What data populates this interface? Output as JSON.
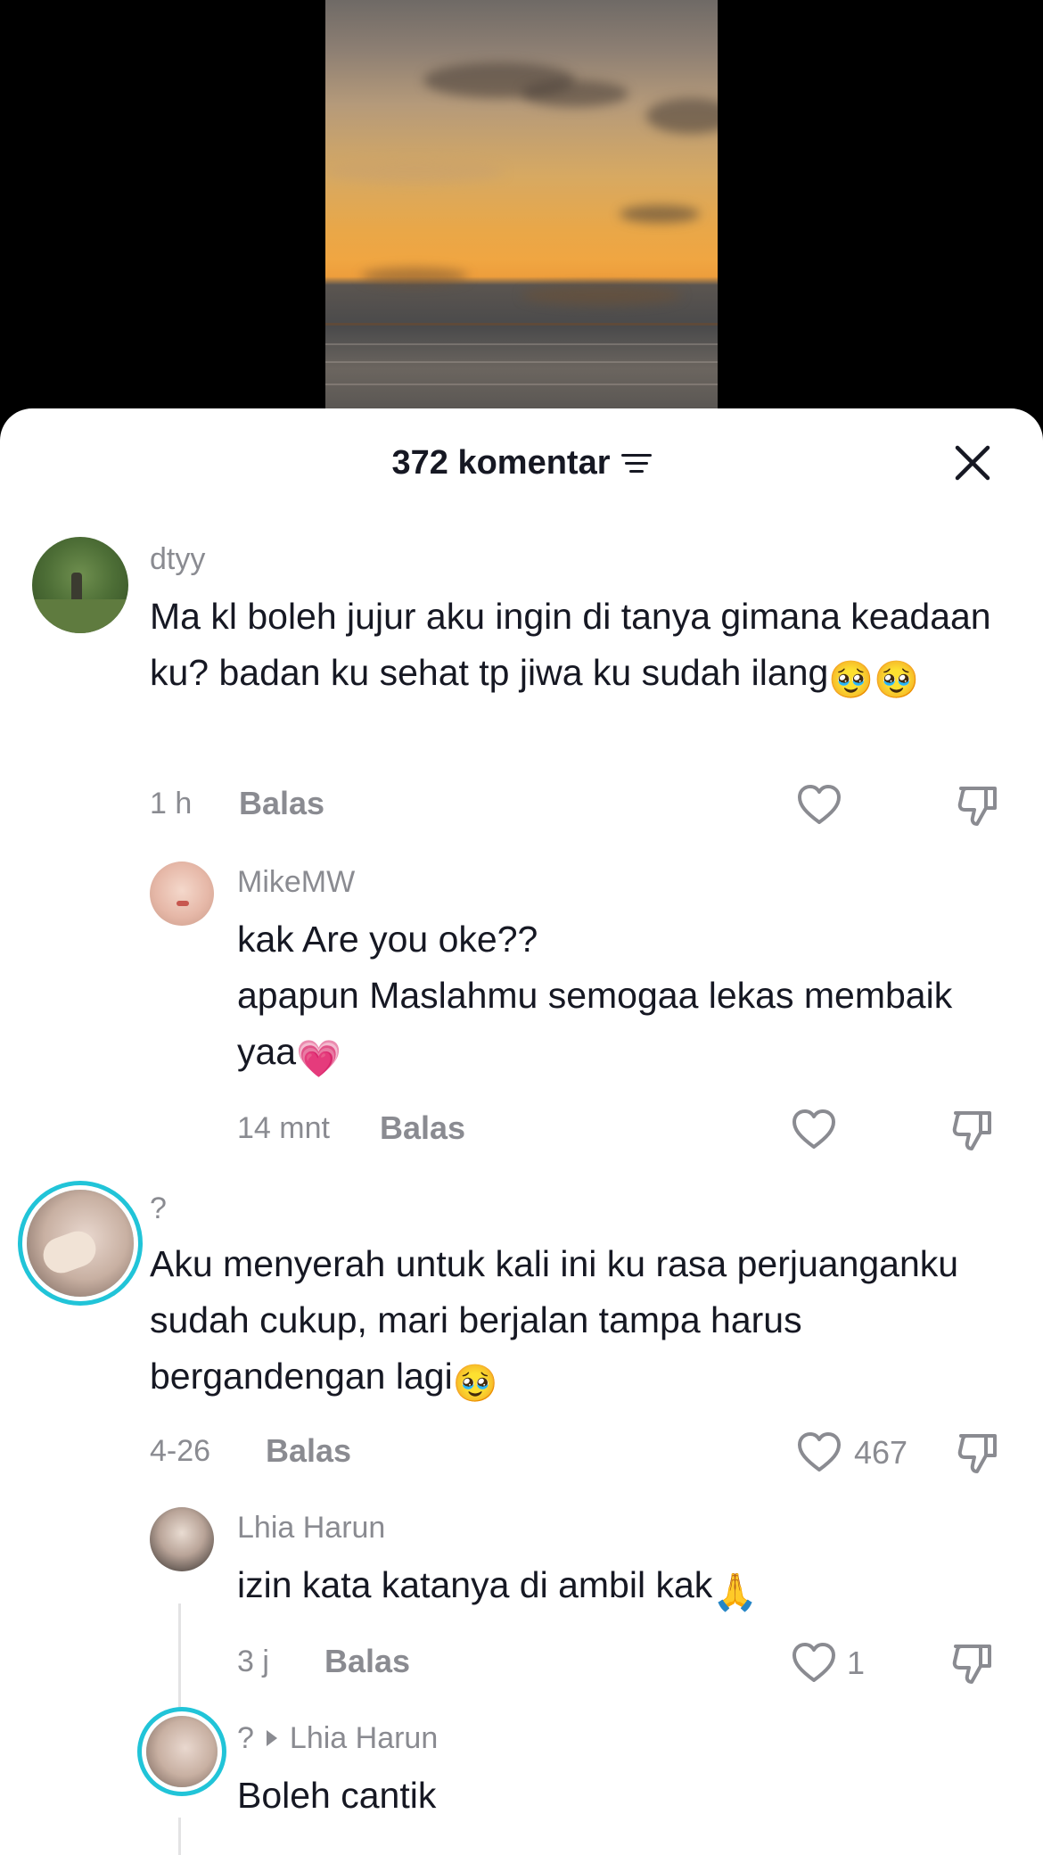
{
  "header": {
    "title": "372 komentar"
  },
  "comments": [
    {
      "username": "dtyy",
      "text": "Ma kl boleh jujur aku ingin di tanya gimana keadaan ku? badan ku sehat tp jiwa ku sudah ilang",
      "emoji": "🥹🥹",
      "time": "1 h",
      "reply_label": "Balas"
    },
    {
      "username": "MikeMW",
      "text_line1": "kak Are you oke??",
      "text_line2": "apapun Maslahmu semogaa lekas membaik yaa",
      "emoji": "💗",
      "time": "14 mnt",
      "reply_label": "Balas"
    },
    {
      "username": "?",
      "text": "Aku menyerah untuk kali ini ku rasa perjuanganku sudah cukup, mari berjalan tampa harus bergandengan lagi",
      "emoji": "🥹",
      "time": "4-26",
      "reply_label": "Balas",
      "likes": "467"
    },
    {
      "username": "Lhia Harun",
      "text": "izin kata katanya di ambil kak",
      "emoji": "🙏",
      "time": "3 j",
      "reply_label": "Balas",
      "likes": "1"
    },
    {
      "username": "?",
      "reply_to": "Lhia Harun",
      "text": "Boleh cantik"
    }
  ],
  "icons": {
    "sort": "sort-icon",
    "close": "close-icon",
    "like": "heart-outline-icon",
    "dislike": "thumbs-down-icon"
  },
  "colors": {
    "text": "#161823",
    "muted": "#8a8b91",
    "ring": "#21c4d8"
  }
}
